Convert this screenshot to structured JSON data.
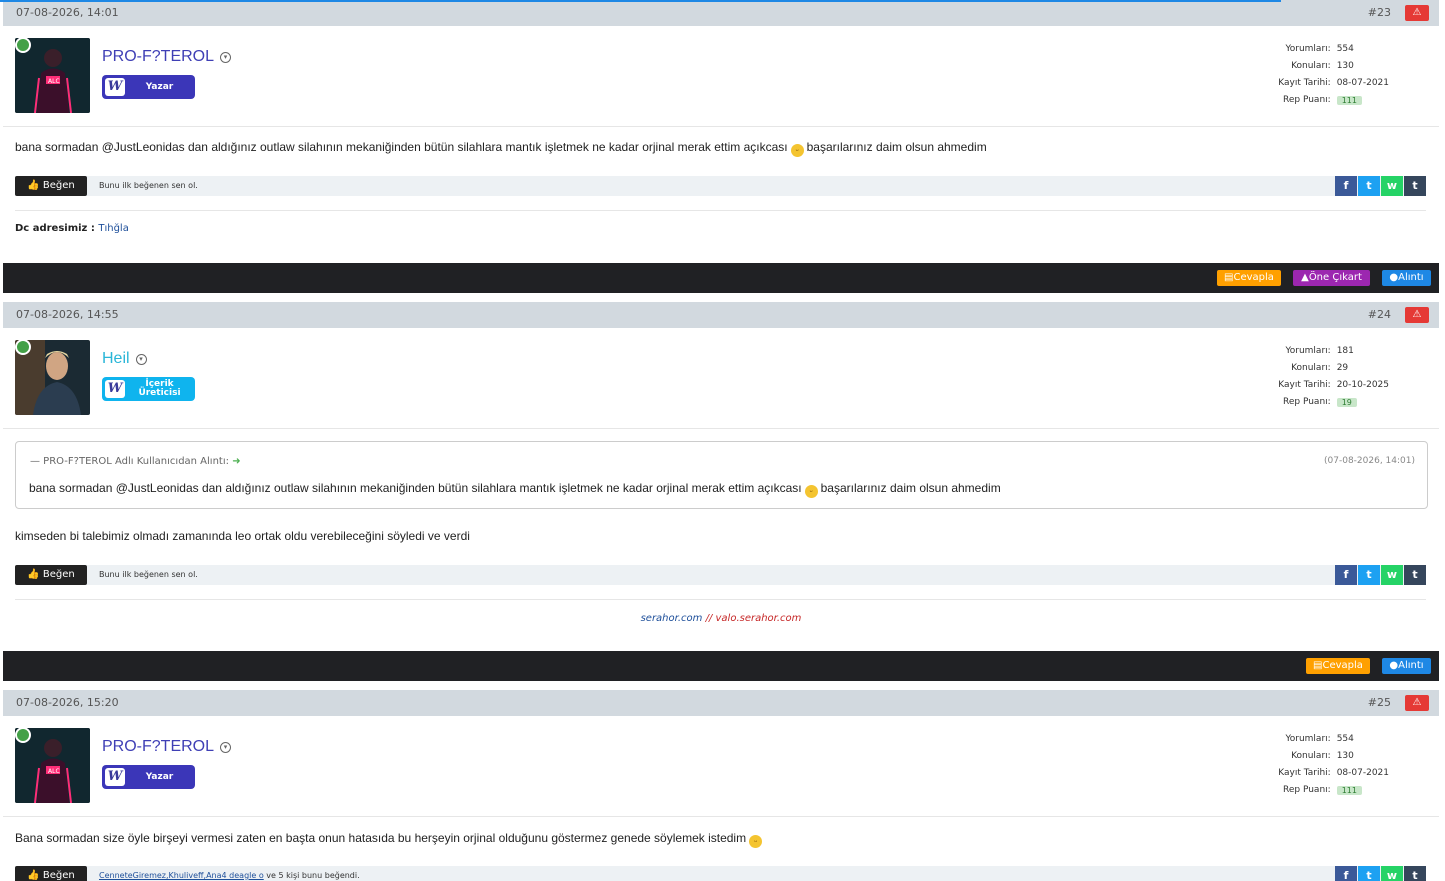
{
  "posts": [
    {
      "date": "07-08-2026, 14:01",
      "num": "#23",
      "user": {
        "name": "PRO-F?TEROL",
        "name_color": "#3f3fb5",
        "badge": "Yazar",
        "badge_color": "#3b36b8",
        "stats": {
          "yorum_label": "Yorumları:",
          "yorum": "554",
          "konu_label": "Konuları:",
          "konu": "130",
          "kayit_label": "Kayıt Tarihi:",
          "kayit": "08-07-2021",
          "rep_label": "Rep Puanı:",
          "rep": "111"
        }
      },
      "text_before": "bana sormadan @JustLeonidas dan aldığınız outlaw silahının mekaniğinden bütün silahlara mantık işletmek ne kadar orjinal merak ettim açıkcası",
      "text_after": "başarılarınız daim olsun ahmedim",
      "like_label": "Beğen",
      "like_text": "Bunu ilk beğenen sen ol.",
      "sig_label": "Dc adresimiz :",
      "sig_link": "Tıhğla",
      "buttons": {
        "reply": "Cevapla",
        "highlight": "Öne Çıkart",
        "quote": "Alıntı"
      }
    },
    {
      "date": "07-08-2026, 14:55",
      "num": "#24",
      "user": {
        "name": "Heil",
        "name_color": "#29b6d8",
        "badge_line1": "İçerik",
        "badge_line2": "Üreticisi",
        "badge_color": "#0fb4ee",
        "stats": {
          "yorum_label": "Yorumları:",
          "yorum": "181",
          "konu_label": "Konuları:",
          "konu": "29",
          "kayit_label": "Kayıt Tarihi:",
          "kayit": "20-10-2025",
          "rep_label": "Rep Puanı:",
          "rep": "19"
        }
      },
      "quote_head": "— PRO-F?TEROL Adlı Kullanıcıdan Alıntı:",
      "quote_date": "(07-08-2026, 14:01)",
      "quote_before": "bana sormadan @JustLeonidas dan aldığınız outlaw silahının mekaniğinden bütün silahlara mantık işletmek ne kadar orjinal merak ettim açıkcası",
      "quote_after": "başarılarınız daim olsun ahmedim",
      "text": "kimseden bi talebimiz olmadı zamanında leo ortak oldu verebileceğini söyledi ve verdi",
      "like_label": "Beğen",
      "like_text": "Bunu ilk beğenen sen ol.",
      "sig_part1": "serahor.com",
      "sig_part2": "//",
      "sig_part3": "valo.serahor.com",
      "buttons": {
        "reply": "Cevapla",
        "quote": "Alıntı"
      }
    },
    {
      "date": "07-08-2026, 15:20",
      "num": "#25",
      "user": {
        "name": "PRO-F?TEROL",
        "badge": "Yazar",
        "stats": {
          "yorum_label": "Yorumları:",
          "yorum": "554",
          "konu_label": "Konuları:",
          "konu": "130",
          "kayit_label": "Kayıt Tarihi:",
          "kayit": "08-07-2021",
          "rep_label": "Rep Puanı:",
          "rep": "111"
        }
      },
      "text": "Bana sormadan size öyle birşeyi vermesi zaten en başta onun hatasıda bu herşeyin orjinal olduğunu göstermez genede söylemek istedim",
      "like_label": "Beğen",
      "like_users": "CenneteGiremez,Khuliveff,Ana4 deagle o",
      "like_suffix": "ve 5 kişi bunu beğendi."
    }
  ],
  "colors": {
    "header_bg": "#d2d9df",
    "footer_bg": "#202124",
    "reply_btn": "#ffa000",
    "highlight_btn": "#9c27b0",
    "quote_btn": "#1e88e5",
    "report_btn": "#e53935"
  },
  "icons": [
    "report-icon",
    "online-dot-icon",
    "dropdown-caret-icon",
    "thumbs-up-icon",
    "facebook-icon",
    "twitter-icon",
    "whatsapp-icon",
    "tumblr-icon",
    "chat-icon",
    "pin-icon",
    "drop-icon",
    "arrow-right-icon",
    "grin-emoji-icon"
  ]
}
